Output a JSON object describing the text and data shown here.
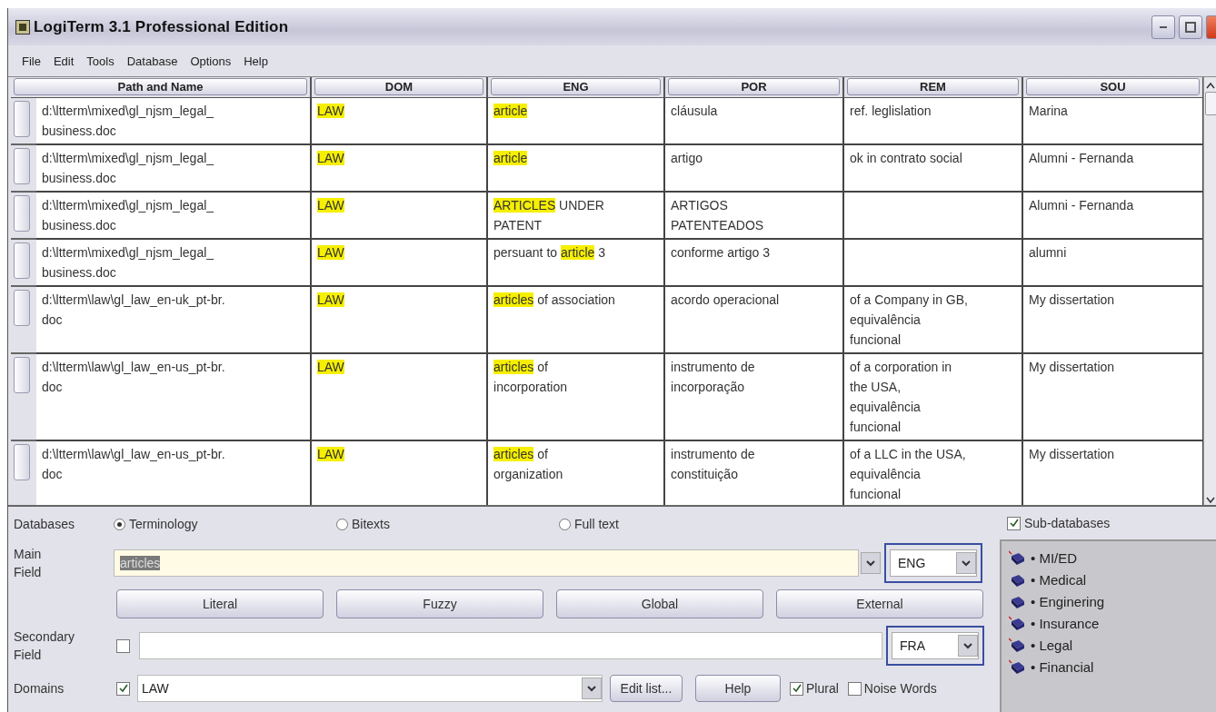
{
  "window": {
    "title": "LogiTerm 3.1 Professional Edition"
  },
  "menu": [
    "File",
    "Edit",
    "Tools",
    "Database",
    "Options",
    "Help"
  ],
  "table": {
    "columns": [
      "Path and Name",
      "DOM",
      "ENG",
      "POR",
      "REM",
      "SOU"
    ],
    "rows": [
      {
        "path": "d:\\ltterm\\mixed\\gl_njsm_legal_\nbusiness.doc",
        "dom": {
          "text": "LAW",
          "highlighted": true
        },
        "eng": [
          {
            "text": "article",
            "highlighted": true
          }
        ],
        "por": "cláusula",
        "rem": "ref. leglislation",
        "sou": "Marina"
      },
      {
        "path": "d:\\ltterm\\mixed\\gl_njsm_legal_\nbusiness.doc",
        "dom": {
          "text": "LAW",
          "highlighted": true
        },
        "eng": [
          {
            "text": "article",
            "highlighted": true
          }
        ],
        "por": "artigo",
        "rem": "ok in contrato social",
        "sou": "Alumni - Fernanda"
      },
      {
        "path": "d:\\ltterm\\mixed\\gl_njsm_legal_\nbusiness.doc",
        "dom": {
          "text": "LAW",
          "highlighted": true
        },
        "eng": [
          {
            "text": "ARTICLES",
            "highlighted": true
          },
          {
            "text": " UNDER\nPATENT",
            "highlighted": false
          }
        ],
        "por": "ARTIGOS\nPATENTEADOS",
        "sou": "Alumni - Fernanda"
      },
      {
        "path": "d:\\ltterm\\mixed\\gl_njsm_legal_\nbusiness.doc",
        "dom": {
          "text": "LAW",
          "highlighted": true
        },
        "eng": [
          {
            "text": "persuant to ",
            "highlighted": false
          },
          {
            "text": "article",
            "highlighted": true
          },
          {
            "text": " 3",
            "highlighted": false
          }
        ],
        "por": "conforme artigo 3",
        "sou": "alumni"
      },
      {
        "path": "d:\\ltterm\\law\\gl_law_en-uk_pt-br.\ndoc",
        "dom": {
          "text": "LAW",
          "highlighted": true
        },
        "eng": [
          {
            "text": "articles",
            "highlighted": true
          },
          {
            "text": " of association",
            "highlighted": false
          }
        ],
        "por": "acordo operacional",
        "rem": "of a Company in GB,\nequivalência\nfuncional",
        "sou": "My dissertation"
      },
      {
        "path": "d:\\ltterm\\law\\gl_law_en-us_pt-br.\ndoc",
        "dom": {
          "text": "LAW",
          "highlighted": true
        },
        "eng": [
          {
            "text": "articles",
            "highlighted": true
          },
          {
            "text": " of\nincorporation",
            "highlighted": false
          }
        ],
        "por": "instrumento de\nincorporação",
        "rem": "of a corporation in\nthe USA,\nequivalência\nfuncional",
        "sou": "My dissertation"
      },
      {
        "path": "d:\\ltterm\\law\\gl_law_en-us_pt-br.\ndoc",
        "dom": {
          "text": "LAW",
          "highlighted": true
        },
        "eng": [
          {
            "text": "articles",
            "highlighted": true
          },
          {
            "text": " of\norganization",
            "highlighted": false
          }
        ],
        "por": "instrumento de\nconstituição",
        "rem": "of a LLC in the USA,\nequivalência\nfuncional",
        "sou": "My dissertation"
      }
    ]
  },
  "databases": {
    "label": "Databases",
    "options": [
      {
        "label": "Terminology",
        "selected": true
      },
      {
        "label": "Bitexts",
        "selected": false
      },
      {
        "label": "Full text",
        "selected": false
      }
    ]
  },
  "main_field": {
    "label": "Main\nField",
    "value": "articles",
    "value_selected": true,
    "language": "ENG"
  },
  "search_buttons": [
    "Literal",
    "Fuzzy",
    "Global",
    "External"
  ],
  "secondary_field": {
    "label": "Secondary\nField",
    "checked": false,
    "language": "FRA"
  },
  "domains": {
    "label": "Domains",
    "checked": true,
    "value": "LAW"
  },
  "domain_buttons": [
    "Edit list...",
    "Help"
  ],
  "options": [
    {
      "label": "Plural",
      "checked": true
    },
    {
      "label": "Noise Words",
      "checked": false
    }
  ],
  "sub_databases": {
    "label": "Sub-databases",
    "checked": true,
    "items": [
      {
        "label": "• MI/ED",
        "marked": true
      },
      {
        "label": "• Medical",
        "marked": false
      },
      {
        "label": "• Enginering",
        "marked": false
      },
      {
        "label": "• Insurance",
        "marked": true
      },
      {
        "label": "• Legal",
        "marked": true
      },
      {
        "label": "• Financial",
        "marked": true
      }
    ]
  }
}
